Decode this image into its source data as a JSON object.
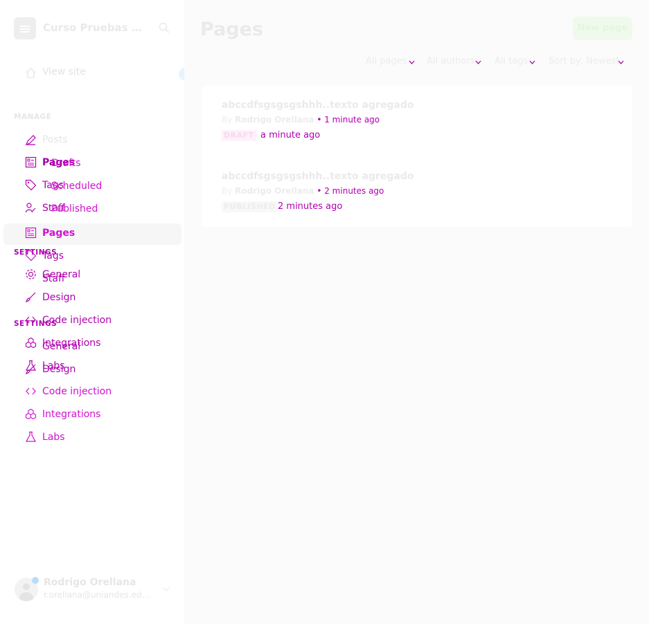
{
  "sidebar": {
    "site_title": "Curso Pruebas de ...",
    "view_site": "View site",
    "sections": {
      "manage": "MANAGE",
      "settings": "SETTINGS"
    },
    "items": {
      "posts": "Posts",
      "drafts": "Drafts",
      "scheduled": "Scheduled",
      "published": "Published",
      "pages": "Pages",
      "tags": "Tags",
      "staff": "Staff",
      "general": "General",
      "design": "Design",
      "code_injection": "Code injection",
      "integrations": "Integrations",
      "labs": "Labs"
    },
    "user": {
      "name": "Rodrigo Orellana",
      "email": "r.orellana@uniandes.edu..."
    }
  },
  "main": {
    "title": "Pages",
    "new_page_button": "New page",
    "filters": {
      "type": "All pages",
      "author": "All authors",
      "tag": "All tags",
      "sort": "Sort by: Newest"
    },
    "rows": [
      {
        "title": "abccdfsgsgsgshhh..texto agregado",
        "by": "By",
        "author": "Rodrigo Orellana",
        "meta_time": "• 1 minute ago",
        "status": "DRAFT",
        "updated": "a minute ago"
      },
      {
        "title": "abccdfsgsgsgshhh..texto agregado",
        "by": "By",
        "author": "Rodrigo Orellana",
        "meta_time": "• 2 minutes ago",
        "status": "PUBLISHED",
        "updated": "2 minutes ago"
      }
    ]
  },
  "colors": {
    "artifact_magenta": "#b000b0",
    "active_bg": "#f6f6f6",
    "main_bg": "#fbfbfb"
  }
}
